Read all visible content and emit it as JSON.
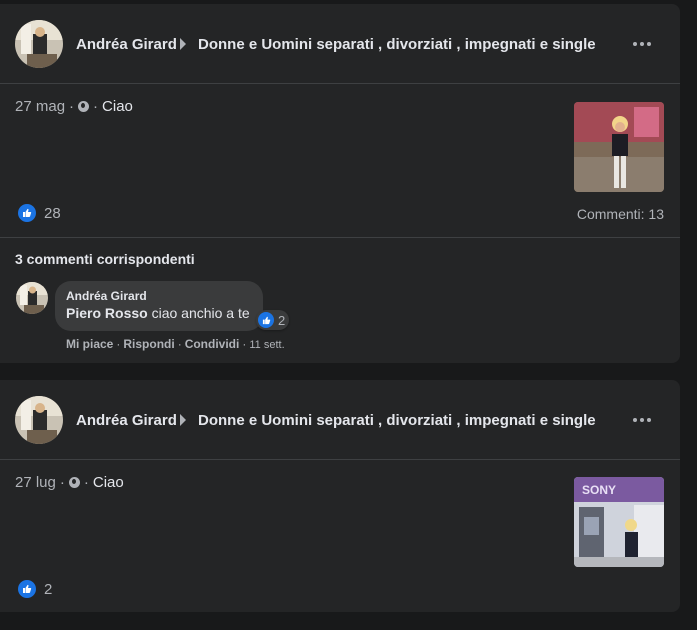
{
  "posts": [
    {
      "author": "Andréa Girard",
      "group": "Donne e Uomini separati , divorziati , impegnati e single",
      "date": "27 mag",
      "sep1": "·",
      "sep2": "·",
      "text": "Ciao",
      "likes": "28",
      "comments": "Commenti: 13",
      "matching_title": "3 commenti corrispondenti",
      "comment": {
        "author": "Andréa Girard",
        "mention": "Piero Rosso",
        "text": " ciao anchio a te",
        "reactions": "2",
        "actions": {
          "like": "Mi piace",
          "reply": "Rispondi",
          "share": "Condividi",
          "sep": "·",
          "time": "11 sett."
        }
      }
    },
    {
      "author": "Andréa Girard",
      "group": "Donne e Uomini separati , divorziati , impegnati e single",
      "date": "27 lug",
      "sep1": "·",
      "sep2": "·",
      "text": "Ciao",
      "likes": "2"
    }
  ],
  "thumb2_sign": "SONY",
  "colors": {
    "background": "#18191a",
    "card": "#242526",
    "like_blue": "#1b74e4",
    "text_primary": "#e4e6eb",
    "text_secondary": "#b0b3b8"
  }
}
